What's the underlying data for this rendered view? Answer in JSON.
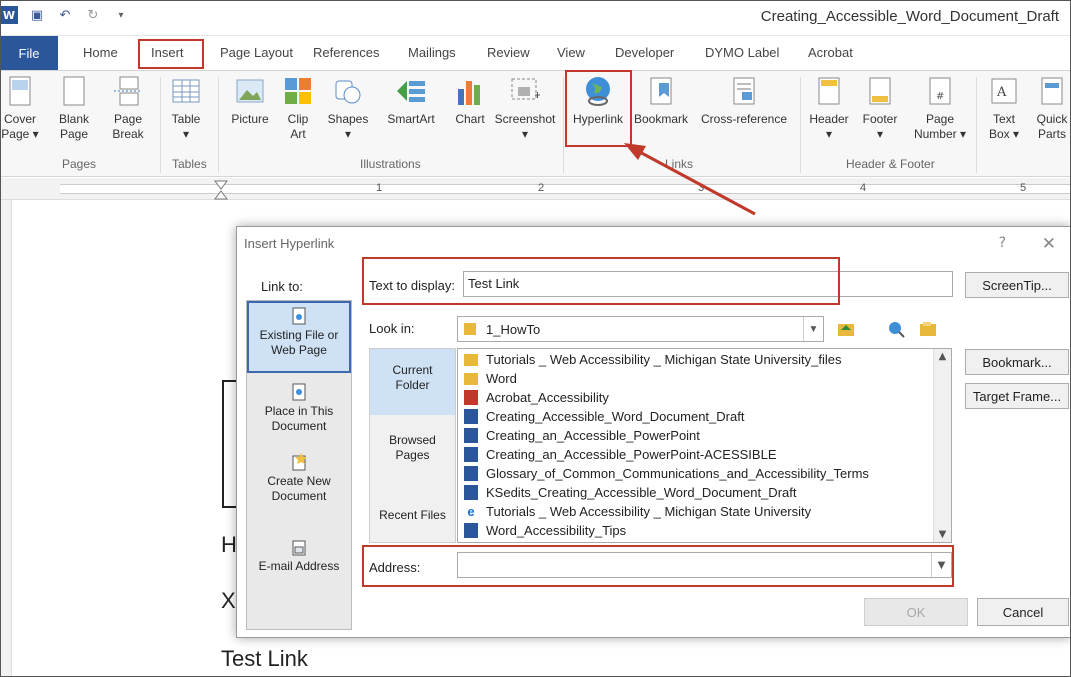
{
  "titlebar": {
    "doc_title": "Creating_Accessible_Word_Document_Draft"
  },
  "tabs": {
    "file": "File",
    "home": "Home",
    "insert": "Insert",
    "page_layout": "Page Layout",
    "references": "References",
    "mailings": "Mailings",
    "review": "Review",
    "view": "View",
    "developer": "Developer",
    "dymo": "DYMO Label",
    "acrobat": "Acrobat"
  },
  "ribbon": {
    "cover_page": [
      "Cover",
      "Page ▾"
    ],
    "blank_page": [
      "Blank",
      "Page"
    ],
    "page_break": [
      "Page",
      "Break"
    ],
    "table": [
      "Table",
      "▾"
    ],
    "picture": "Picture",
    "clip_art": [
      "Clip",
      "Art"
    ],
    "shapes": [
      "Shapes",
      "▾"
    ],
    "smartart": "SmartArt",
    "chart": "Chart",
    "screenshot": [
      "Screenshot",
      "▾"
    ],
    "hyperlink": "Hyperlink",
    "bookmark": "Bookmark",
    "cross_reference": "Cross-reference",
    "header": [
      "Header",
      "▾"
    ],
    "footer": [
      "Footer",
      "▾"
    ],
    "page_number": [
      "Page",
      "Number ▾"
    ],
    "text_box": [
      "Text",
      "Box ▾"
    ],
    "quick_parts": [
      "Quick",
      "Parts"
    ],
    "groups": {
      "pages": "Pages",
      "tables": "Tables",
      "illustrations": "Illustrations",
      "links": "Links",
      "header_footer": "Header & Footer"
    }
  },
  "ruler": {
    "numbers": [
      "1",
      "2",
      "3",
      "4",
      "5"
    ]
  },
  "document": {
    "line_h": "H",
    "line_x": "X",
    "test_link": "Test Link"
  },
  "dialog": {
    "title": "Insert Hyperlink",
    "help": "?",
    "close": "✕",
    "link_to_label": "Link to:",
    "link_options": {
      "existing": [
        "Existing File or",
        "Web Page"
      ],
      "place": [
        "Place in This",
        "Document"
      ],
      "new_doc": [
        "Create New",
        "Document"
      ],
      "email": "E-mail Address"
    },
    "text_to_display_label": "Text to display:",
    "text_to_display_value": "Test Link",
    "screentip_button": "ScreenTip...",
    "look_in_label": "Look in:",
    "look_in_value": "1_HowTo",
    "bookmark_button": "Bookmark...",
    "target_frame_button": "Target Frame...",
    "nav": {
      "current": [
        "Current",
        "Folder"
      ],
      "browsed": [
        "Browsed",
        "Pages"
      ],
      "recent": "Recent Files"
    },
    "files": [
      {
        "name": "Tutorials _ Web Accessibility _ Michigan State University_files",
        "icon": "folder"
      },
      {
        "name": "Word",
        "icon": "folder"
      },
      {
        "name": "Acrobat_Accessibility",
        "icon": "pdf"
      },
      {
        "name": "Creating_Accessible_Word_Document_Draft",
        "icon": "word"
      },
      {
        "name": "Creating_an_Accessible_PowerPoint",
        "icon": "word"
      },
      {
        "name": "Creating_an_Accessible_PowerPoint-ACESSIBLE",
        "icon": "word"
      },
      {
        "name": "Glossary_of_Common_Communications_and_Accessibility_Terms",
        "icon": "word"
      },
      {
        "name": "KSedits_Creating_Accessible_Word_Document_Draft",
        "icon": "word"
      },
      {
        "name": "Tutorials _ Web Accessibility _ Michigan State University",
        "icon": "ie"
      },
      {
        "name": "Word_Accessibility_Tips",
        "icon": "word"
      }
    ],
    "address_label": "Address:",
    "address_value": "",
    "ok_button": "OK",
    "cancel_button": "Cancel"
  },
  "colors": {
    "highlight_red": "#c0392b",
    "file_tab_blue": "#2b579a",
    "selected_blue": "#cfe2f5"
  }
}
